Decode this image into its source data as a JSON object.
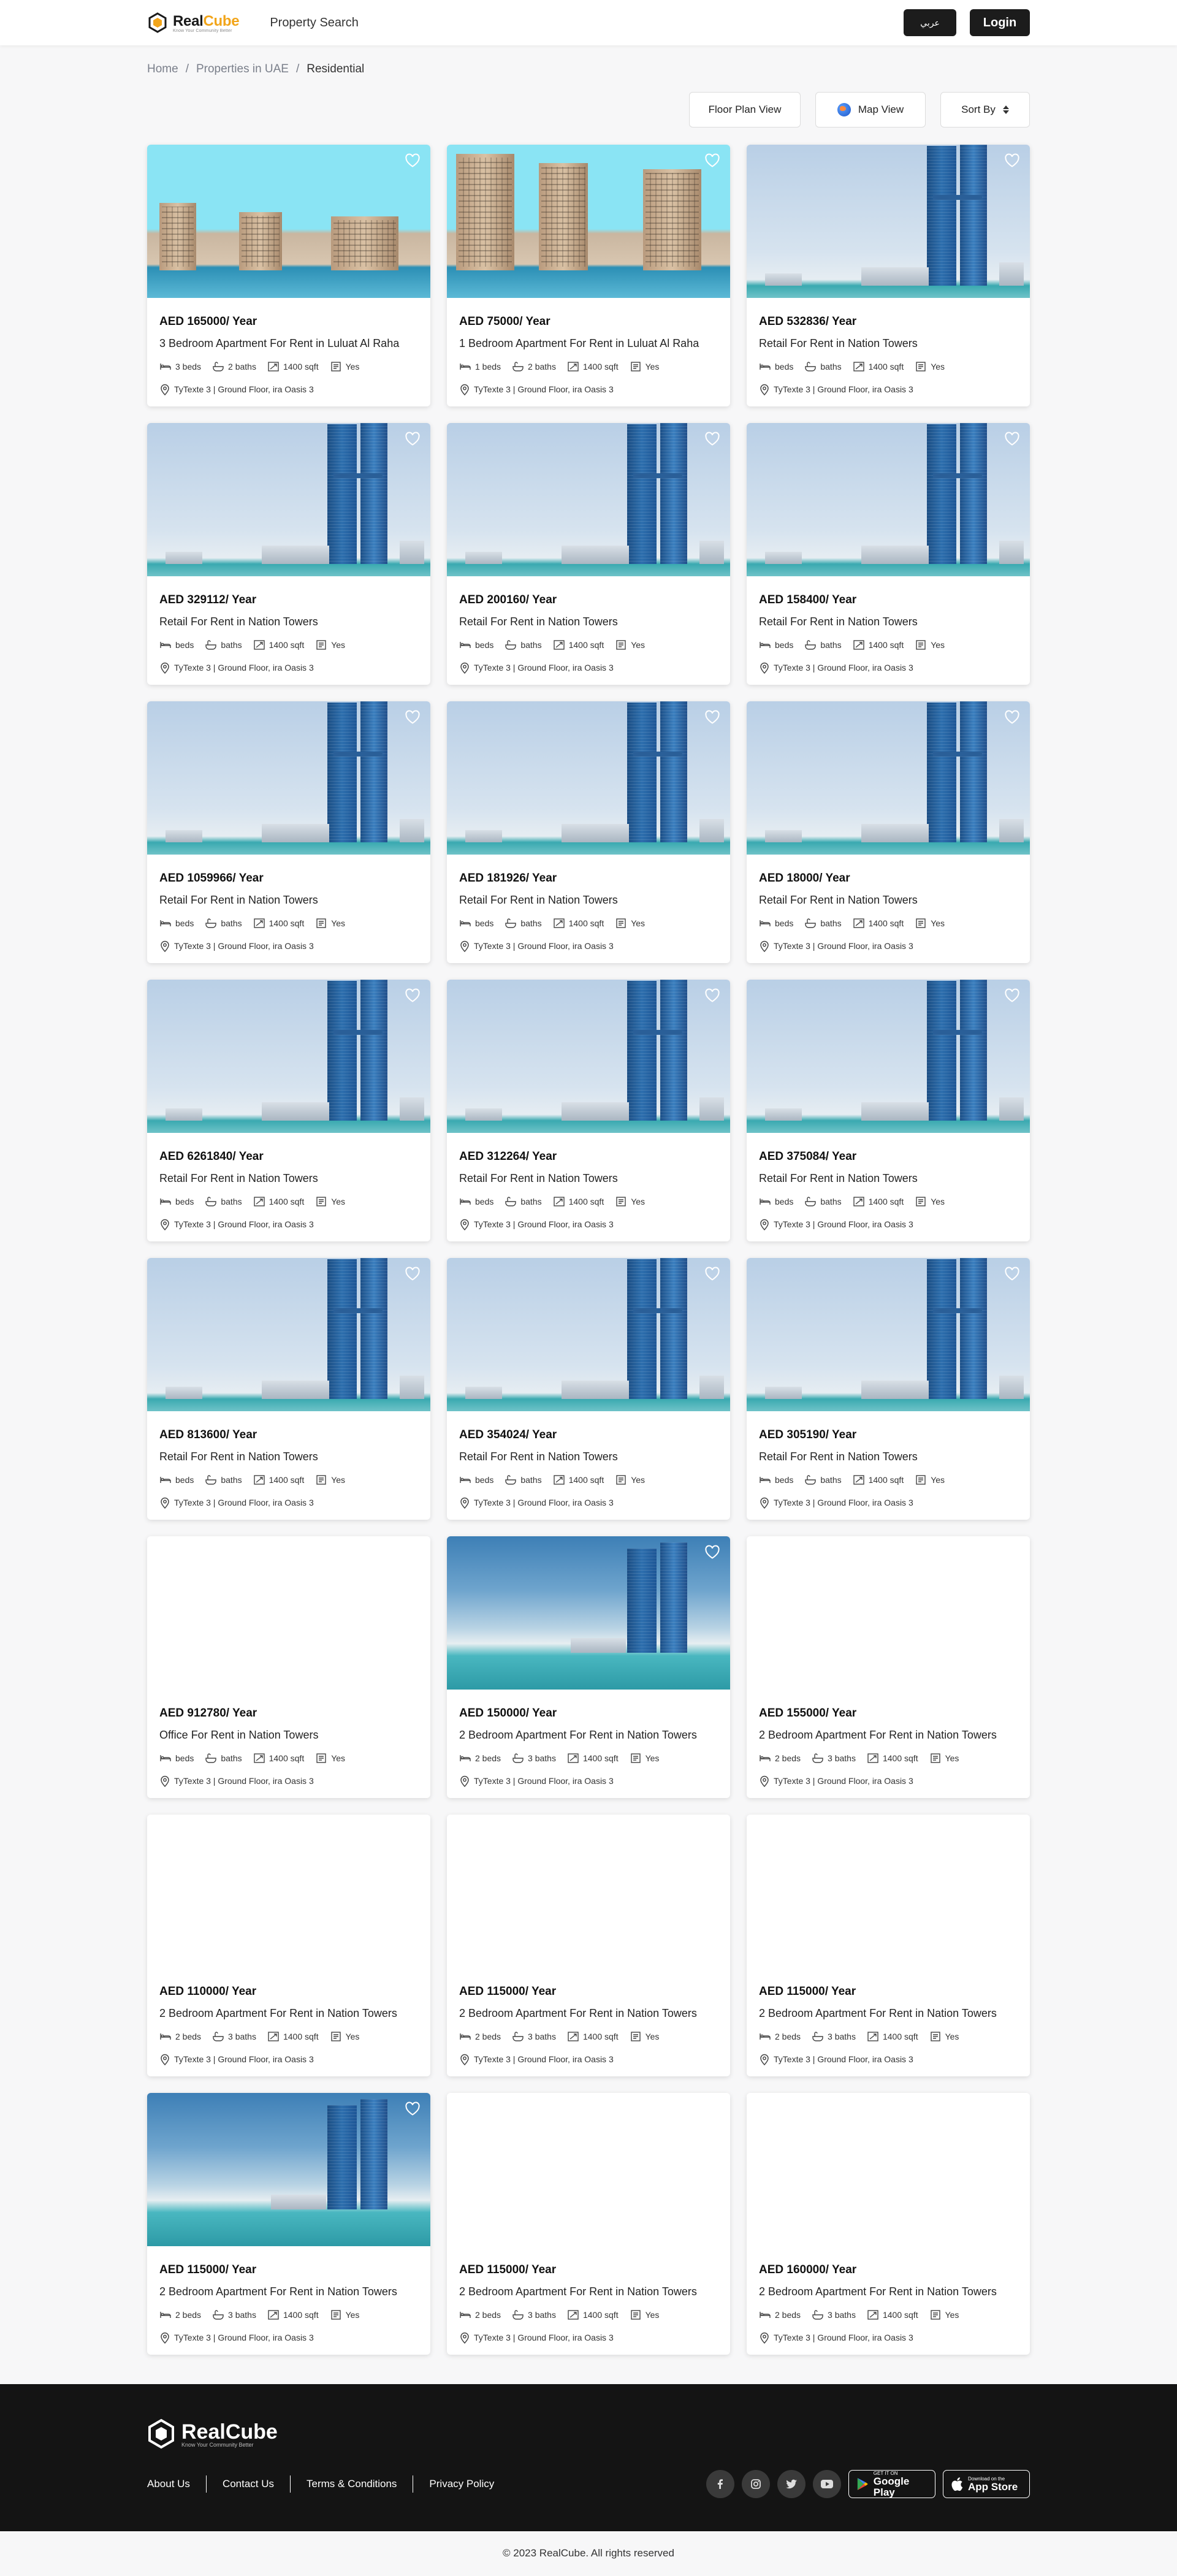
{
  "header": {
    "logo_real": "Real",
    "logo_cube": "Cube",
    "logo_tagline": "Know Your Community Better",
    "nav_property_search": "Property Search",
    "arabic_label": "عربي",
    "login_label": "Login"
  },
  "breadcrumb": {
    "home": "Home",
    "uae": "Properties in UAE",
    "current": "Residential"
  },
  "toolbar": {
    "floor_plan": "Floor Plan View",
    "map_view": "Map View",
    "sort_by": "Sort By"
  },
  "listings": [
    {
      "price": "AED 165000/ Year",
      "title": "3 Bedroom Apartment For Rent in Luluat Al Raha",
      "beds": "3 beds",
      "baths": "2 baths",
      "area": "1400 sqft",
      "furnished": "Yes",
      "location": "TyTexte 3 | Ground Floor, ira Oasis 3",
      "image": "raha1"
    },
    {
      "price": "AED 75000/ Year",
      "title": "1 Bedroom Apartment For Rent in Luluat Al Raha",
      "beds": "1 beds",
      "baths": "2 baths",
      "area": "1400 sqft",
      "furnished": "Yes",
      "location": "TyTexte 3 | Ground Floor, ira Oasis 3",
      "image": "raha2"
    },
    {
      "price": "AED 532836/ Year",
      "title": "Retail For Rent in Nation Towers",
      "beds": "beds",
      "baths": "baths",
      "area": "1400 sqft",
      "furnished": "Yes",
      "location": "TyTexte 3 | Ground Floor, ira Oasis 3",
      "image": "tower"
    },
    {
      "price": "AED 329112/ Year",
      "title": "Retail For Rent in Nation Towers",
      "beds": "beds",
      "baths": "baths",
      "area": "1400 sqft",
      "furnished": "Yes",
      "location": "TyTexte 3 | Ground Floor, ira Oasis 3",
      "image": "tower"
    },
    {
      "price": "AED 200160/ Year",
      "title": "Retail For Rent in Nation Towers",
      "beds": "beds",
      "baths": "baths",
      "area": "1400 sqft",
      "furnished": "Yes",
      "location": "TyTexte 3 | Ground Floor, ira Oasis 3",
      "image": "tower"
    },
    {
      "price": "AED 158400/ Year",
      "title": "Retail For Rent in Nation Towers",
      "beds": "beds",
      "baths": "baths",
      "area": "1400 sqft",
      "furnished": "Yes",
      "location": "TyTexte 3 | Ground Floor, ira Oasis 3",
      "image": "tower"
    },
    {
      "price": "AED 1059966/ Year",
      "title": "Retail For Rent in Nation Towers",
      "beds": "beds",
      "baths": "baths",
      "area": "1400 sqft",
      "furnished": "Yes",
      "location": "TyTexte 3 | Ground Floor, ira Oasis 3",
      "image": "tower"
    },
    {
      "price": "AED 181926/ Year",
      "title": "Retail For Rent in Nation Towers",
      "beds": "beds",
      "baths": "baths",
      "area": "1400 sqft",
      "furnished": "Yes",
      "location": "TyTexte 3 | Ground Floor, ira Oasis 3",
      "image": "tower"
    },
    {
      "price": "AED 18000/ Year",
      "title": "Retail For Rent in Nation Towers",
      "beds": "beds",
      "baths": "baths",
      "area": "1400 sqft",
      "furnished": "Yes",
      "location": "TyTexte 3 | Ground Floor, ira Oasis 3",
      "image": "tower"
    },
    {
      "price": "AED 6261840/ Year",
      "title": "Retail For Rent in Nation Towers",
      "beds": "beds",
      "baths": "baths",
      "area": "1400 sqft",
      "furnished": "Yes",
      "location": "TyTexte 3 | Ground Floor, ira Oasis 3",
      "image": "tower"
    },
    {
      "price": "AED 312264/ Year",
      "title": "Retail For Rent in Nation Towers",
      "beds": "beds",
      "baths": "baths",
      "area": "1400 sqft",
      "furnished": "Yes",
      "location": "TyTexte 3 | Ground Floor, ira Oasis 3",
      "image": "tower"
    },
    {
      "price": "AED 375084/ Year",
      "title": "Retail For Rent in Nation Towers",
      "beds": "beds",
      "baths": "baths",
      "area": "1400 sqft",
      "furnished": "Yes",
      "location": "TyTexte 3 | Ground Floor, ira Oasis 3",
      "image": "tower"
    },
    {
      "price": "AED 813600/ Year",
      "title": "Retail For Rent in Nation Towers",
      "beds": "beds",
      "baths": "baths",
      "area": "1400 sqft",
      "furnished": "Yes",
      "location": "TyTexte 3 | Ground Floor, ira Oasis 3",
      "image": "tower"
    },
    {
      "price": "AED 354024/ Year",
      "title": "Retail For Rent in Nation Towers",
      "beds": "beds",
      "baths": "baths",
      "area": "1400 sqft",
      "furnished": "Yes",
      "location": "TyTexte 3 | Ground Floor, ira Oasis 3",
      "image": "tower"
    },
    {
      "price": "AED 305190/ Year",
      "title": "Retail For Rent in Nation Towers",
      "beds": "beds",
      "baths": "baths",
      "area": "1400 sqft",
      "furnished": "Yes",
      "location": "TyTexte 3 | Ground Floor, ira Oasis 3",
      "image": "tower"
    },
    {
      "price": "AED 912780/ Year",
      "title": "Office For Rent in Nation Towers",
      "beds": "beds",
      "baths": "baths",
      "area": "1400 sqft",
      "furnished": "Yes",
      "location": "TyTexte 3 | Ground Floor, ira Oasis 3",
      "image": "blank"
    },
    {
      "price": "AED 150000/ Year",
      "title": "2 Bedroom Apartment For Rent in Nation Towers",
      "beds": "2 beds",
      "baths": "3 baths",
      "area": "1400 sqft",
      "furnished": "Yes",
      "location": "TyTexte 3 | Ground Floor, ira Oasis 3",
      "image": "seatower"
    },
    {
      "price": "AED 155000/ Year",
      "title": "2 Bedroom Apartment For Rent in Nation Towers",
      "beds": "2 beds",
      "baths": "3 baths",
      "area": "1400 sqft",
      "furnished": "Yes",
      "location": "TyTexte 3 | Ground Floor, ira Oasis 3",
      "image": "blank"
    },
    {
      "price": "AED 110000/ Year",
      "title": "2 Bedroom Apartment For Rent in Nation Towers",
      "beds": "2 beds",
      "baths": "3 baths",
      "area": "1400 sqft",
      "furnished": "Yes",
      "location": "TyTexte 3 | Ground Floor, ira Oasis 3",
      "image": "blank"
    },
    {
      "price": "AED 115000/ Year",
      "title": "2 Bedroom Apartment For Rent in Nation Towers",
      "beds": "2 beds",
      "baths": "3 baths",
      "area": "1400 sqft",
      "furnished": "Yes",
      "location": "TyTexte 3 | Ground Floor, ira Oasis 3",
      "image": "blank"
    },
    {
      "price": "AED 115000/ Year",
      "title": "2 Bedroom Apartment For Rent in Nation Towers",
      "beds": "2 beds",
      "baths": "3 baths",
      "area": "1400 sqft",
      "furnished": "Yes",
      "location": "TyTexte 3 | Ground Floor, ira Oasis 3",
      "image": "blank"
    },
    {
      "price": "AED 115000/ Year",
      "title": "2 Bedroom Apartment For Rent in Nation Towers",
      "beds": "2 beds",
      "baths": "3 baths",
      "area": "1400 sqft",
      "furnished": "Yes",
      "location": "TyTexte 3 | Ground Floor, ira Oasis 3",
      "image": "seatower"
    },
    {
      "price": "AED 115000/ Year",
      "title": "2 Bedroom Apartment For Rent in Nation Towers",
      "beds": "2 beds",
      "baths": "3 baths",
      "area": "1400 sqft",
      "furnished": "Yes",
      "location": "TyTexte 3 | Ground Floor, ira Oasis 3",
      "image": "blank"
    },
    {
      "price": "AED 160000/ Year",
      "title": "2 Bedroom Apartment For Rent in Nation Towers",
      "beds": "2 beds",
      "baths": "3 baths",
      "area": "1400 sqft",
      "furnished": "Yes",
      "location": "TyTexte 3 | Ground Floor, ira Oasis 3",
      "image": "blank"
    }
  ],
  "footer": {
    "logo_name": "RealCube",
    "logo_tagline": "Know Your Community Better",
    "links": [
      "About Us",
      "Contact Us",
      "Terms & Conditions",
      "Privacy Policy"
    ],
    "google_play_small": "GET IT ON",
    "google_play_big": "Google Play",
    "app_store_small": "Download on the",
    "app_store_big": "App Store"
  },
  "copyright": "© 2023 RealCube. All rights reserved",
  "colors": {
    "brand_orange": "#f2a51a",
    "dark": "#1c1c1c",
    "footer_bg": "#141414"
  }
}
